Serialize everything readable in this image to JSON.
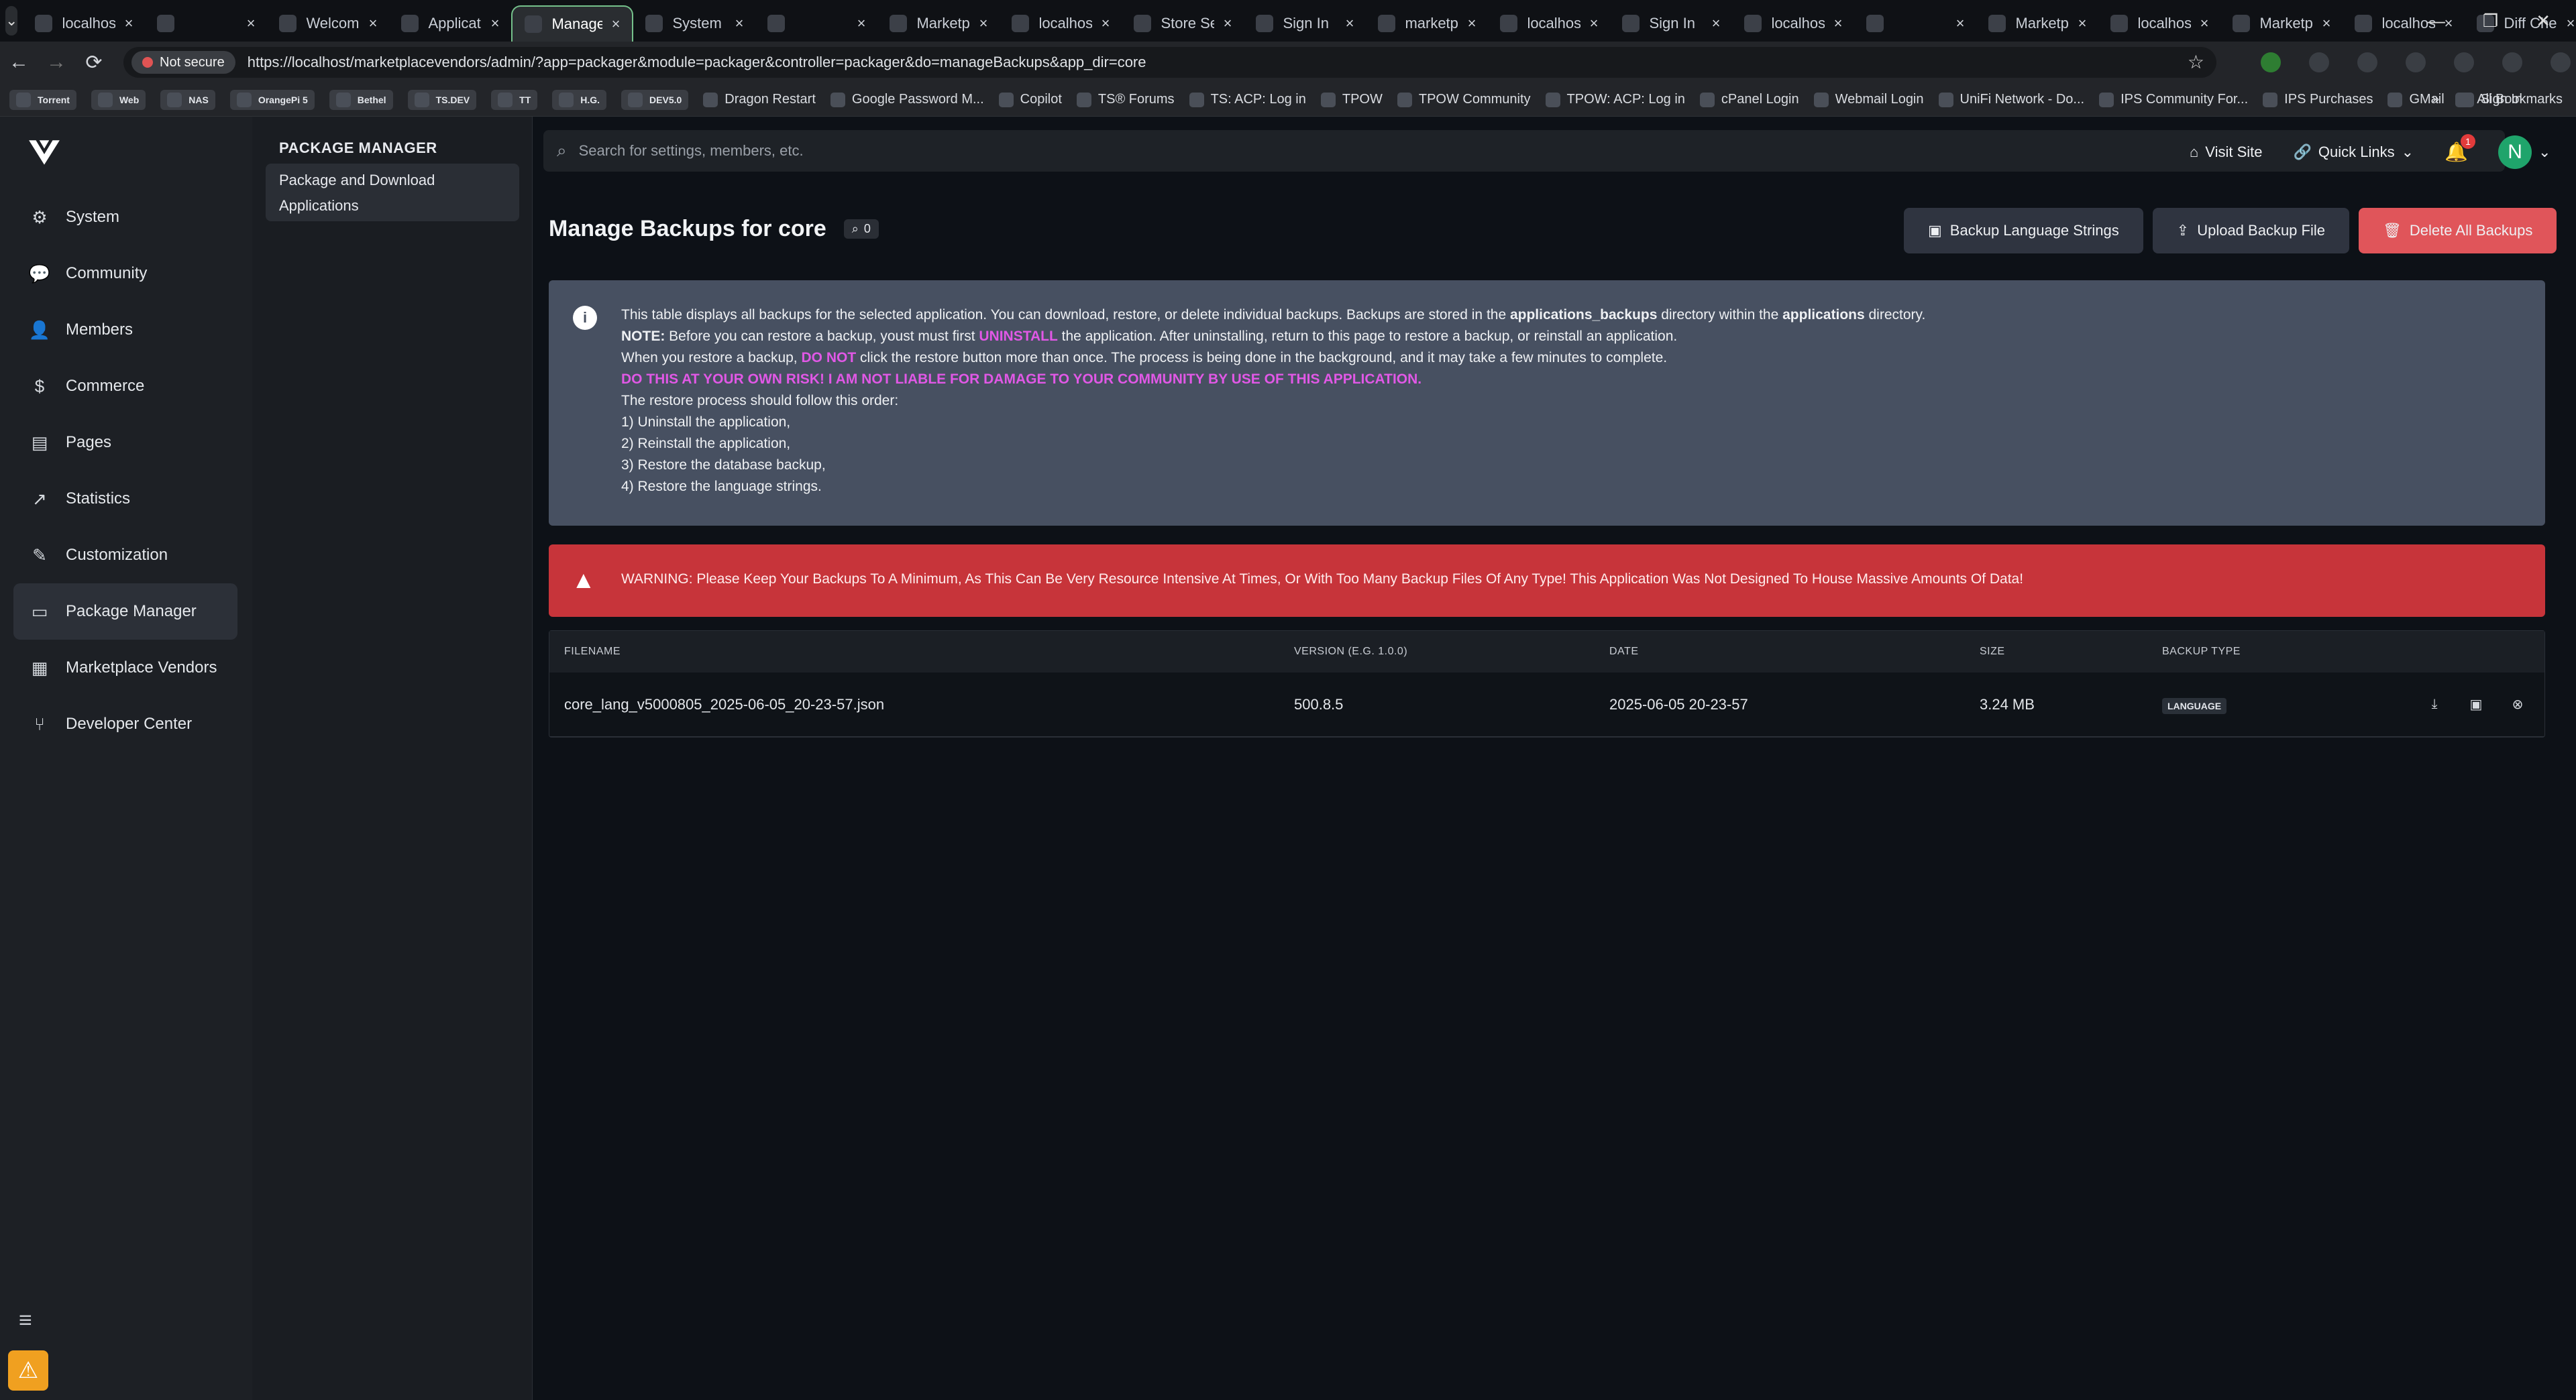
{
  "browser": {
    "tabs": [
      {
        "title": "localhost",
        "active": false
      },
      {
        "title": "",
        "active": false
      },
      {
        "title": "Welcome",
        "active": false
      },
      {
        "title": "Application",
        "active": false
      },
      {
        "title": "Manage B",
        "active": true
      },
      {
        "title": "System L",
        "active": false
      },
      {
        "title": "",
        "active": false
      },
      {
        "title": "Marketpl",
        "active": false
      },
      {
        "title": "localhost",
        "active": false
      },
      {
        "title": "Store Set",
        "active": false
      },
      {
        "title": "Sign In",
        "active": false
      },
      {
        "title": "marketpl",
        "active": false
      },
      {
        "title": "localhost",
        "active": false
      },
      {
        "title": "Sign In",
        "active": false
      },
      {
        "title": "localhost",
        "active": false
      },
      {
        "title": "",
        "active": false
      },
      {
        "title": "Marketpl",
        "active": false
      },
      {
        "title": "localhost",
        "active": false
      },
      {
        "title": "Marketpl",
        "active": false
      },
      {
        "title": "localhost",
        "active": false
      },
      {
        "title": "Diff Chec",
        "active": false
      }
    ],
    "address": {
      "security_label": "Not secure",
      "url": "https://localhost/marketplacevendors/admin/?app=packager&module=packager&controller=packager&do=manageBackups&app_dir=core"
    },
    "bookmarks": [
      "Torrent",
      "Web",
      "NAS",
      "OrangePi 5",
      "Bethel",
      "TS.DEV",
      "TT",
      "H.G.",
      "DEV5.0",
      "Dragon Restart",
      "Google Password M...",
      "Copilot",
      "TS® Forums",
      "TS: ACP: Log in",
      "TPOW",
      "TPOW Community",
      "TPOW: ACP: Log in",
      "cPanel Login",
      "Webmail Login",
      "UniFi Network - Do...",
      "IPS Community For...",
      "IPS Purchases",
      "GMail",
      "Sign In"
    ],
    "all_bookmarks": "All Bookmarks"
  },
  "sidebar": {
    "items": [
      {
        "label": "System",
        "icon": "gears-icon"
      },
      {
        "label": "Community",
        "icon": "comments-icon"
      },
      {
        "label": "Members",
        "icon": "user-icon"
      },
      {
        "label": "Commerce",
        "icon": "dollar-icon"
      },
      {
        "label": "Pages",
        "icon": "page-icon"
      },
      {
        "label": "Statistics",
        "icon": "chart-icon"
      },
      {
        "label": "Customization",
        "icon": "brush-icon"
      },
      {
        "label": "Package Manager",
        "icon": "archive-icon",
        "active": true
      },
      {
        "label": "Marketplace Vendors",
        "icon": "store-icon"
      },
      {
        "label": "Developer Center",
        "icon": "branch-icon"
      }
    ]
  },
  "subnav": {
    "title": "PACKAGE MANAGER",
    "item_line1": "Package and Download",
    "item_line2": "Applications"
  },
  "header": {
    "search_placeholder": "Search for settings, members, etc.",
    "visit_site": "Visit Site",
    "quick_links": "Quick Links",
    "notifications": "1",
    "avatar_letter": "N"
  },
  "page": {
    "title": "Manage Backups for core",
    "count": "0",
    "buttons": {
      "backup_lang": "Backup Language Strings",
      "upload": "Upload Backup File",
      "delete_all": "Delete All Backups"
    }
  },
  "info": {
    "l1a": "This table displays all backups for the selected application. You can download, restore, or delete individual backups. Backups are stored in the ",
    "l1b": "applications_backups",
    "l1c": " directory within the ",
    "l1d": "applications",
    "l1e": " directory.",
    "l2a": "NOTE:",
    "l2b": " Before you can restore a backup, youst must first ",
    "l2c": "UNINSTALL",
    "l2d": " the application. After uninstalling, return to this page to restore a backup, or reinstall an application.",
    "l3a": "When you restore a backup, ",
    "l3b": "DO NOT",
    "l3c": " click the restore button more than once. The process is being done in the background, and it may take a few minutes to complete.",
    "l4": "DO THIS AT YOUR OWN RISK! I AM NOT LIABLE FOR DAMAGE TO YOUR COMMUNITY BY USE OF THIS APPLICATION.",
    "l5": "The restore process should follow this order:",
    "l6": "1) Uninstall the application,",
    "l7": "2) Reinstall the application,",
    "l8": "3) Restore the database backup,",
    "l9": "4) Restore the language strings."
  },
  "warning": {
    "text": "WARNING: Please Keep Your Backups To A Minimum, As This Can Be Very Resource Intensive At Times, Or With Too Many Backup Files Of Any Type! This Application Was Not Designed To House Massive Amounts Of Data!"
  },
  "table": {
    "headers": [
      "FILENAME",
      "VERSION (E.G. 1.0.0)",
      "DATE",
      "SIZE",
      "BACKUP TYPE"
    ],
    "rows": [
      {
        "filename": "core_lang_v5000805_2025-06-05_20-23-57.json",
        "version": "500.8.5",
        "date": "2025-06-05 20-23-57",
        "size": "3.24 MB",
        "type": "LANGUAGE"
      }
    ]
  },
  "colors": {
    "danger": "#e0555a",
    "info_bg": "#475061",
    "warning_bg": "#c7343a",
    "accent_pink": "#e158e6"
  }
}
